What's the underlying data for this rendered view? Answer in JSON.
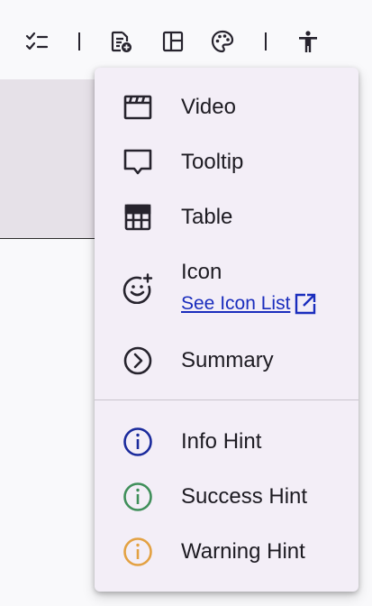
{
  "toolbar": {
    "icons": [
      "checklist-icon",
      "insert-block-icon",
      "layout-icon",
      "palette-icon",
      "accessibility-icon"
    ]
  },
  "menu": {
    "items": [
      {
        "label": "Video",
        "icon": "video-icon"
      },
      {
        "label": "Tooltip",
        "icon": "tooltip-icon"
      },
      {
        "label": "Table",
        "icon": "table-icon"
      },
      {
        "label": "Icon",
        "icon": "add-emoji-icon",
        "link": "See Icon List",
        "link_icon": "open-in-new-icon"
      },
      {
        "label": "Summary",
        "icon": "chevron-right-circle-icon"
      }
    ],
    "hints": [
      {
        "label": "Info Hint",
        "icon": "info-icon",
        "color": "#1a2a9c"
      },
      {
        "label": "Success Hint",
        "icon": "info-icon",
        "color": "#3f8f5a"
      },
      {
        "label": "Warning Hint",
        "icon": "info-icon",
        "color": "#e3a142"
      }
    ]
  }
}
